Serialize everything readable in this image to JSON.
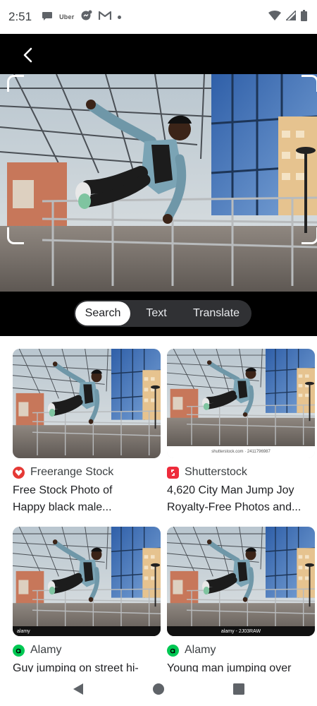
{
  "status_bar": {
    "time": "2:51",
    "notification_uber": "Uber"
  },
  "lens": {
    "mode_tabs": [
      {
        "label": "Search",
        "active": true
      },
      {
        "label": "Text",
        "active": false
      },
      {
        "label": "Translate",
        "active": false
      }
    ]
  },
  "results": [
    {
      "source": "Freerange Stock",
      "source_icon": "freerange-logo-icon",
      "source_color": "#e53935",
      "title_line1": "Free Stock Photo of",
      "title_line2": "Happy black male...",
      "watermark": ""
    },
    {
      "source": "Shutterstock",
      "source_icon": "shutterstock-logo-icon",
      "source_color": "#ee2b3b",
      "title_line1": "4,620 City Man Jump Joy",
      "title_line2": "Royalty-Free Photos and...",
      "watermark": "shutterstock.com · 2411796987"
    },
    {
      "source": "Alamy",
      "source_icon": "alamy-logo-icon",
      "source_color": "#00c853",
      "title_line1": "Guy jumping on street hi-",
      "title_line2": "",
      "watermark": "alamy"
    },
    {
      "source": "Alamy",
      "source_icon": "alamy-logo-icon",
      "source_color": "#00c853",
      "title_line1": "Young man jumping over",
      "title_line2": "",
      "watermark": "alamy - 2J03RAW"
    }
  ],
  "colors": {
    "lens_background": "#000000",
    "switch_background": "#303134",
    "active_tab": "#ffffff"
  }
}
